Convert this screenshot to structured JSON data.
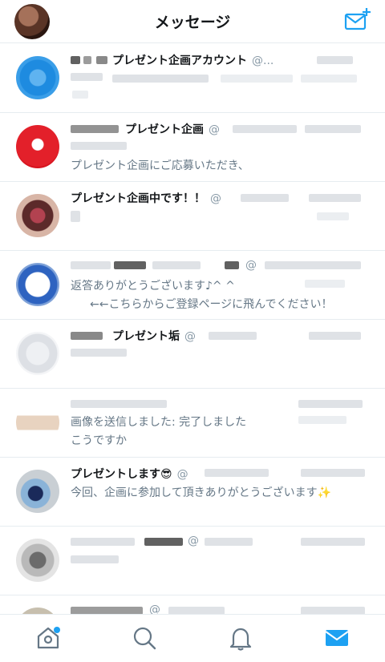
{
  "header": {
    "title": "メッセージ",
    "compose_icon": "compose-envelope-icon"
  },
  "conversations": [
    {
      "name": "プレゼント企画アカウント",
      "handle": "@...",
      "lines": []
    },
    {
      "name": "プレゼント企画",
      "handle": "@",
      "lines": [
        "プレゼント企画にご応募いただき、"
      ]
    },
    {
      "name": "プレゼント企画中です！！",
      "handle": "@",
      "lines": []
    },
    {
      "name": "",
      "handle": "@",
      "lines": [
        "返答ありがとうございます♪^ ^",
        "←←こちらからご登録ページに飛んでください！"
      ]
    },
    {
      "name": "プレゼント垢",
      "handle": "@",
      "lines": []
    },
    {
      "name": "",
      "handle": "",
      "lines": [
        "画像を送信しました: 完了しました",
        "こうですか"
      ]
    },
    {
      "name": "プレゼントします😎",
      "handle": "@",
      "lines": [
        "今回、企画に参加して頂きありがとうございます✨"
      ]
    },
    {
      "name": "",
      "handle": "@",
      "lines": []
    },
    {
      "name": "",
      "handle": "@",
      "lines": []
    }
  ],
  "tabbar": {
    "home_icon": "home-icon",
    "search_icon": "search-icon",
    "notifications_icon": "bell-icon",
    "messages_icon": "mail-icon",
    "active_tab": "messages"
  },
  "colors": {
    "accent": "#1da1f2",
    "text_primary": "#14171a",
    "text_secondary": "#657786",
    "divider": "#e6ecf0"
  }
}
